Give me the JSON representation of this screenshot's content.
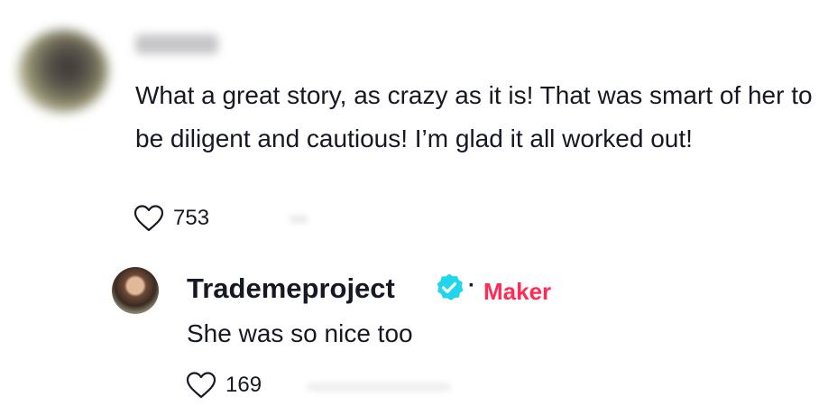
{
  "comment": {
    "text": "What a great story, as crazy as it is! That was smart of her to be diligent and cautious! I’m glad it all worked out!",
    "likes": "753",
    "like_icon": "heart-outline-icon"
  },
  "reply": {
    "author": "Trademeproject",
    "verified_icon": "verified-badge-icon",
    "separator": "·",
    "badge": "Maker",
    "text": "She was so nice too",
    "likes": "169",
    "like_icon": "heart-outline-icon"
  },
  "colors": {
    "text": "#161823",
    "maker_badge": "#fe2c55",
    "verified": "#20d5ec"
  }
}
